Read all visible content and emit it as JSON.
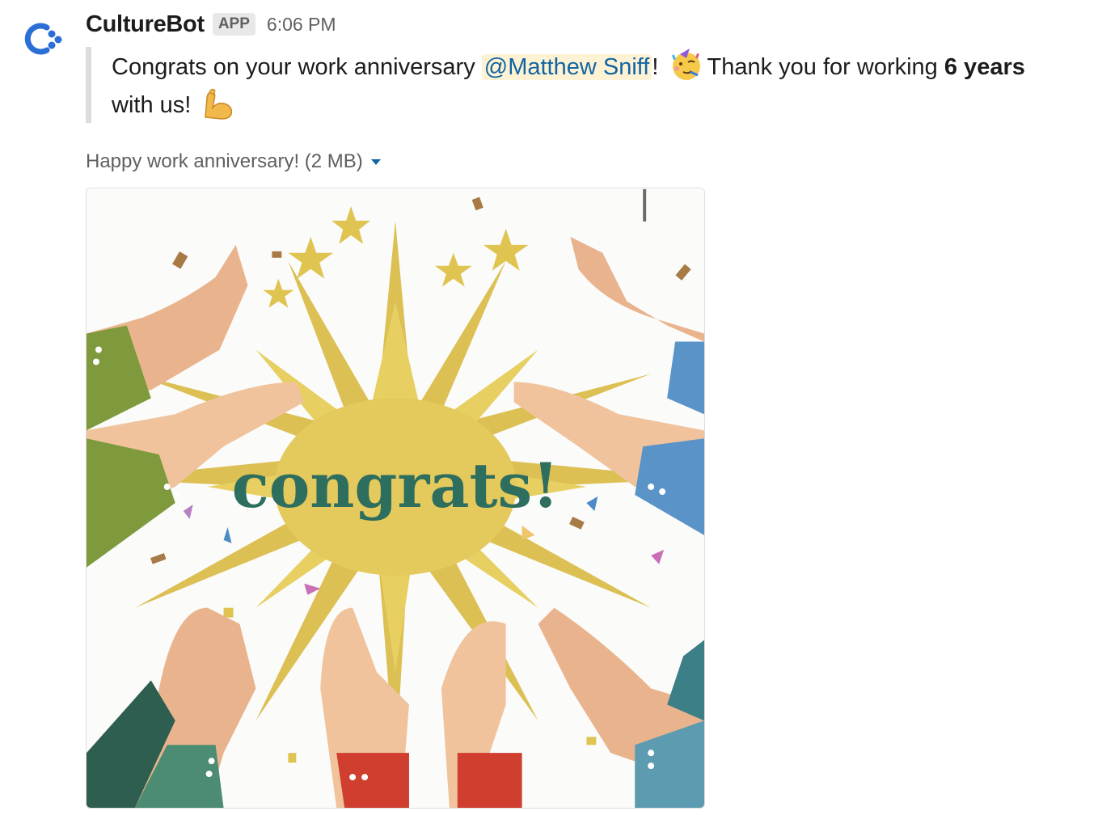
{
  "bot": {
    "name": "CultureBot",
    "badge": "APP",
    "time": "6:06 PM",
    "avatar_icon": "culturebot-logo-icon"
  },
  "message": {
    "text_1": "Congrats on your work anniversary",
    "mention": "@Matthew Sniff",
    "text_2": "!",
    "emoji_1": "partying-face-emoji",
    "text_3": "Thank you for working",
    "bold": "6 years",
    "text_4": "with us!",
    "emoji_2": "flexed-biceps-emoji"
  },
  "attachment": {
    "title": "Happy work anniversary! (2 MB)",
    "image_text": "congrats!"
  },
  "colors": {
    "mention_bg": "#fdf3d4",
    "mention_fg": "#1264a3",
    "burst": "#dcc054",
    "congrats_text": "#2e6e5f",
    "logo_blue": "#2b6fd6"
  }
}
